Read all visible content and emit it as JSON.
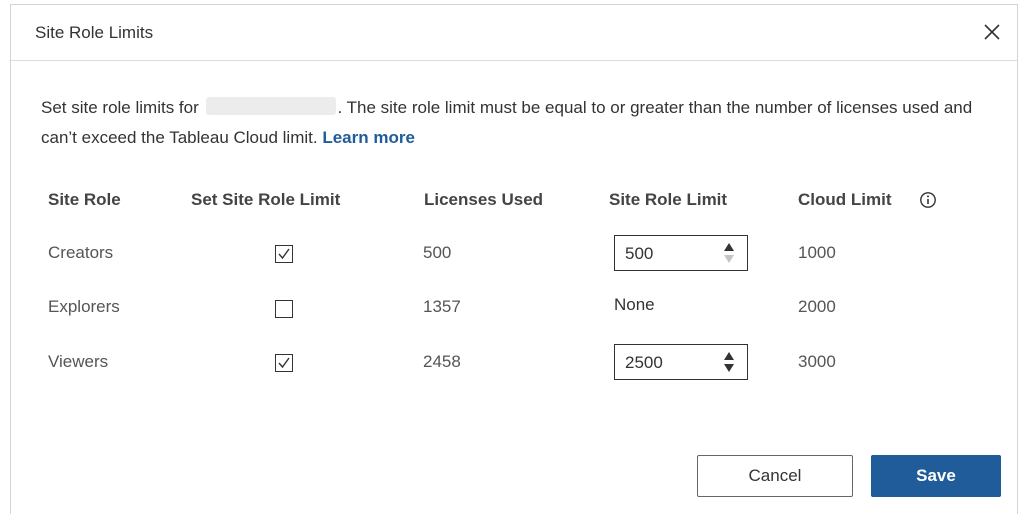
{
  "dialog": {
    "title": "Site Role Limits",
    "close_label": "×"
  },
  "description": {
    "prefix": "Set site role limits for",
    "suffix": ". The site role limit must be equal to or greater than the number of licenses used and can’t exceed the Tableau Cloud limit.",
    "learn_more": "Learn more"
  },
  "table": {
    "headers": [
      "Site Role",
      "Set Site Role Limit",
      "Licenses Used",
      "Site Role Limit",
      "Cloud Limit"
    ],
    "rows": [
      {
        "role": "Creators",
        "checked": true,
        "licenses_used": "500",
        "site_role_limit": "500",
        "cloud_limit": "1000"
      },
      {
        "role": "Explorers",
        "checked": false,
        "licenses_used": "1357",
        "site_role_limit": "None",
        "cloud_limit": "2000"
      },
      {
        "role": "Viewers",
        "checked": true,
        "licenses_used": "2458",
        "site_role_limit": "2500",
        "cloud_limit": "3000"
      }
    ]
  },
  "buttons": {
    "cancel": "Cancel",
    "save": "Save"
  },
  "colors": {
    "accent": "#1f5c99",
    "text": "#333333"
  },
  "icons": {
    "close": "close-icon",
    "info": "info-icon",
    "check": "checkmark-icon",
    "stepper": "up-down-arrows-icon"
  }
}
